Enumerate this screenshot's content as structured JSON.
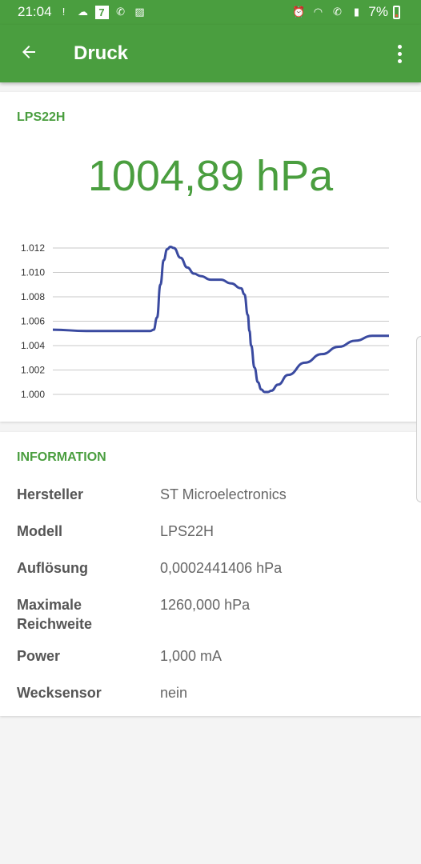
{
  "status_bar": {
    "time": "21:04",
    "badge": "7",
    "battery": "7%",
    "left_icons": [
      "alert-icon",
      "cloud-icon",
      "seven-badge",
      "wifi-call-icon",
      "image-icon"
    ],
    "right_icons": [
      "alarm-icon",
      "wifi-icon",
      "wifi-call-icon",
      "signal-icon",
      "battery-icon"
    ]
  },
  "app_bar": {
    "title": "Druck",
    "back_icon": "arrow-left-icon",
    "menu_icon": "more-vert-icon"
  },
  "sensor": {
    "name": "LPS22H",
    "value": "1004,89 hPa"
  },
  "chart_data": {
    "type": "line",
    "y_ticks": [
      "1.012",
      "1.010",
      "1.008",
      "1.006",
      "1.004",
      "1.002",
      "1.000"
    ],
    "ylim": [
      1.0,
      1.012
    ],
    "x": [
      0,
      0.1,
      0.2,
      0.29,
      0.3,
      0.31,
      0.32,
      0.33,
      0.34,
      0.35,
      0.36,
      0.38,
      0.4,
      0.42,
      0.44,
      0.47,
      0.5,
      0.53,
      0.56,
      0.57,
      0.58,
      0.585,
      0.59,
      0.6,
      0.61,
      0.62,
      0.63,
      0.64,
      0.65,
      0.67,
      0.7,
      0.75,
      0.8,
      0.85,
      0.9,
      0.95,
      1.0
    ],
    "values": [
      1.0053,
      1.0052,
      1.0052,
      1.0052,
      1.0053,
      1.0063,
      1.009,
      1.011,
      1.0119,
      1.0121,
      1.012,
      1.0112,
      1.0104,
      1.0099,
      1.0097,
      1.0094,
      1.0094,
      1.0091,
      1.0087,
      1.0082,
      1.0065,
      1.0052,
      1.004,
      1.0022,
      1.001,
      1.0004,
      1.0002,
      1.0002,
      1.0003,
      1.0008,
      1.0016,
      1.0026,
      1.0033,
      1.0039,
      1.0044,
      1.0048,
      1.0048
    ],
    "line_color": "#3a4aa0",
    "grid": true
  },
  "info": {
    "heading": "INFORMATION",
    "rows": [
      {
        "key": "Hersteller",
        "value": "ST Microelectronics"
      },
      {
        "key": "Modell",
        "value": "LPS22H"
      },
      {
        "key": "Auflösung",
        "value": "0,0002441406 hPa"
      },
      {
        "key": "Maximale Reichweite",
        "value": "1260,000 hPa"
      },
      {
        "key": "Power",
        "value": "1,000 mA"
      },
      {
        "key": "Wecksensor",
        "value": "nein"
      }
    ]
  },
  "colors": {
    "accent": "#4a9e3f",
    "chart_line": "#3a4aa0",
    "background": "#f4f4f4"
  }
}
